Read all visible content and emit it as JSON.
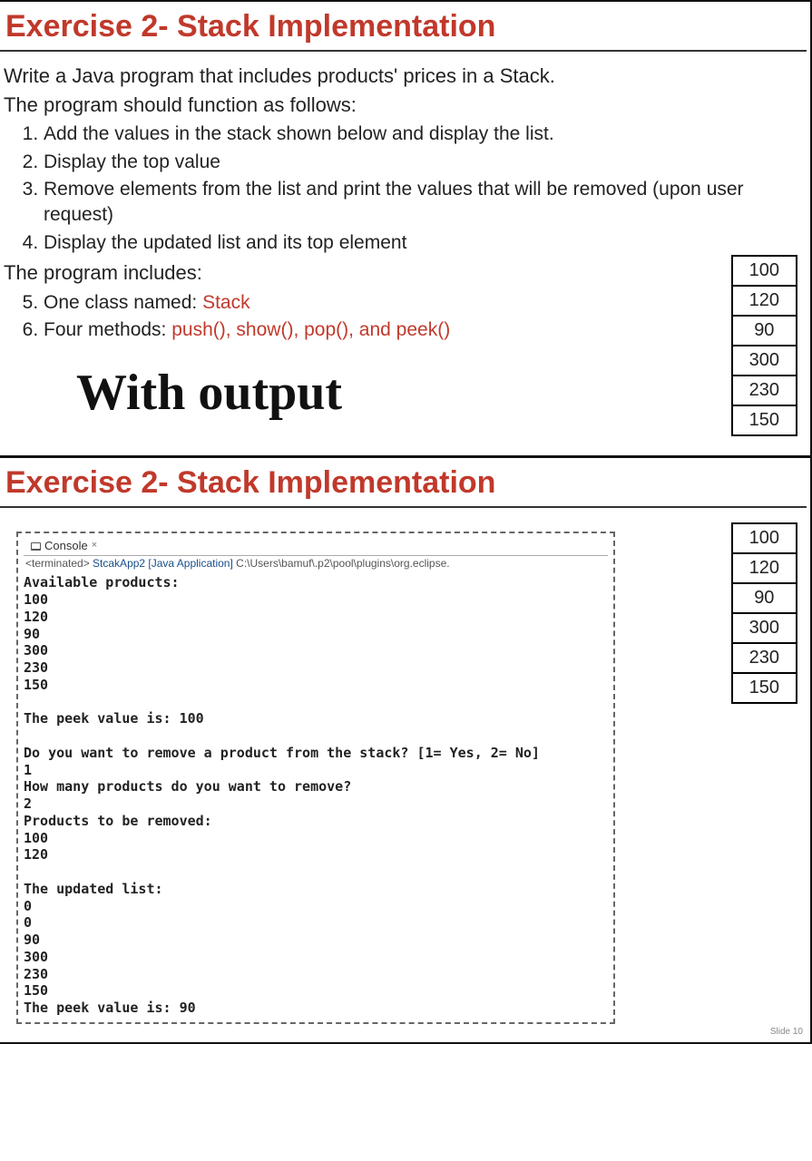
{
  "slide1": {
    "title": "Exercise 2- Stack Implementation",
    "intro_line1": "Write a Java program that includes products' prices in a Stack.",
    "intro_line2": "The program should function as follows:",
    "step1": "Add the values in the stack shown below and display the list.",
    "step2": "Display the top value",
    "step3": "Remove elements from the list and print the values that will be removed (upon user request)",
    "step4": "Display the updated list and its top element",
    "includes_label": "The program includes:",
    "step5_prefix": "One class named: ",
    "step5_class": "Stack",
    "step6_prefix": "Four methods: ",
    "step6_methods": "push(),  show(),  pop(), and peek()",
    "with_output": "With output",
    "stack": [
      "100",
      "120",
      "90",
      "300",
      "230",
      "150"
    ]
  },
  "slide2": {
    "title": "Exercise 2- Stack Implementation",
    "console_tab": "Console",
    "console_close": "×",
    "terminated_prefix": "<terminated> ",
    "terminated_app": "StcakApp2 [Java Application]",
    "terminated_path": " C:\\Users\\bamuf\\.p2\\pool\\plugins\\org.eclipse.",
    "output": "Available products:\n100\n120\n90\n300\n230\n150\n\nThe peek value is: 100\n\nDo you want to remove a product from the stack? [1= Yes, 2= No]\n1\nHow many products do you want to remove?\n2\nProducts to be removed:\n100\n120\n\nThe updated list:\n0\n0\n90\n300\n230\n150\nThe peek value is: 90",
    "stack": [
      "100",
      "120",
      "90",
      "300",
      "230",
      "150"
    ],
    "slide_num": "Slide 10"
  }
}
